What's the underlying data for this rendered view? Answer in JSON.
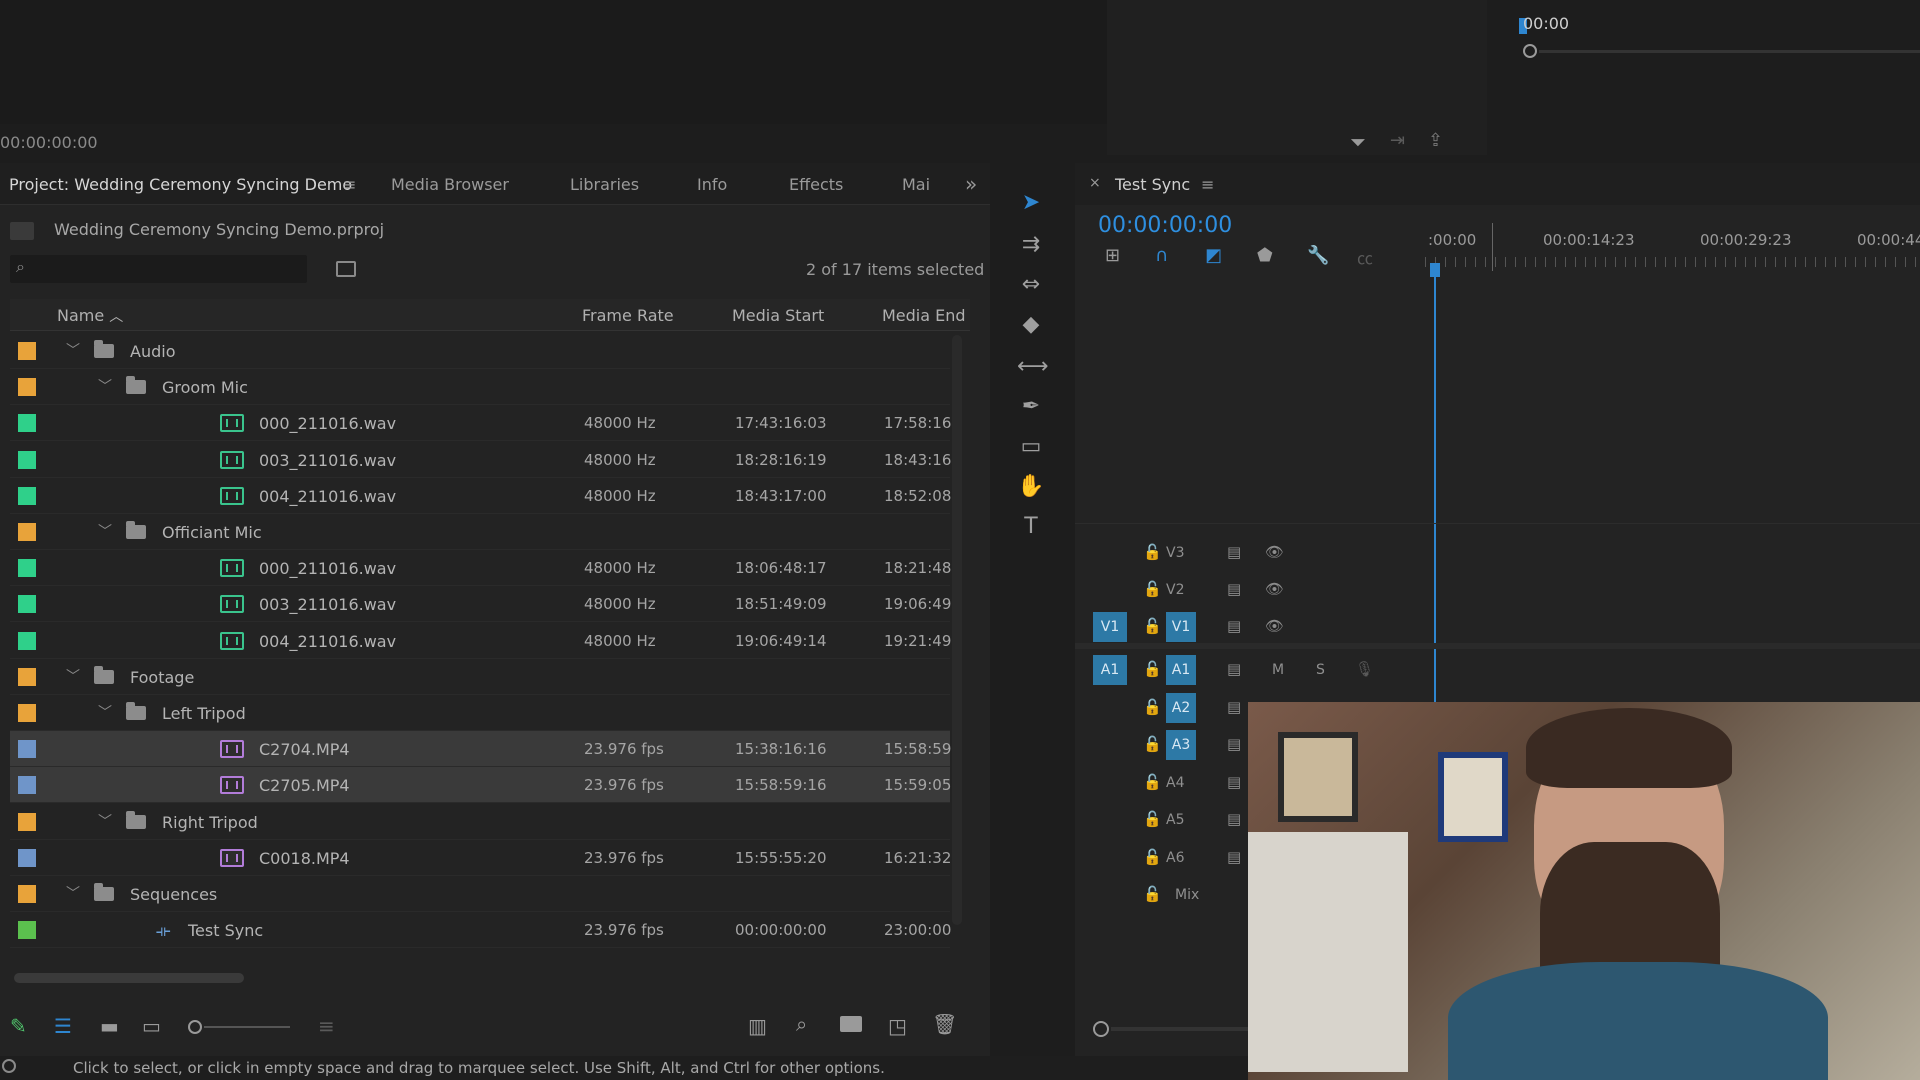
{
  "source_monitor": {
    "timecode": "00:00:00:00"
  },
  "program_monitor": {
    "timecode": "00:00"
  },
  "project_panel": {
    "tabs": [
      {
        "label": "Project: Wedding Ceremony Syncing Demo"
      },
      {
        "label": "Media Browser"
      },
      {
        "label": "Libraries"
      },
      {
        "label": "Info"
      },
      {
        "label": "Effects"
      },
      {
        "label": "Mai"
      }
    ],
    "project_file": "Wedding Ceremony Syncing Demo.prproj",
    "selection_count": "2 of 17 items selected",
    "columns": {
      "name": "Name",
      "frame_rate": "Frame Rate",
      "media_start": "Media Start",
      "media_end": "Media End"
    },
    "rows": [
      {
        "name": "Audio",
        "kind": "folder",
        "level": 0,
        "color": "#e8a33a",
        "fr": "",
        "start": "",
        "end": ""
      },
      {
        "name": "Groom Mic",
        "kind": "folder",
        "level": 1,
        "color": "#e8a33a",
        "fr": "",
        "start": "",
        "end": ""
      },
      {
        "name": "000_211016.wav",
        "kind": "audio",
        "level": 2,
        "color": "#2fd08a",
        "fr": "48000 Hz",
        "start": "17:43:16:03",
        "end": "17:58:16"
      },
      {
        "name": "003_211016.wav",
        "kind": "audio",
        "level": 2,
        "color": "#2fd08a",
        "fr": "48000 Hz",
        "start": "18:28:16:19",
        "end": "18:43:16"
      },
      {
        "name": "004_211016.wav",
        "kind": "audio",
        "level": 2,
        "color": "#2fd08a",
        "fr": "48000 Hz",
        "start": "18:43:17:00",
        "end": "18:52:08"
      },
      {
        "name": "Officiant Mic",
        "kind": "folder",
        "level": 1,
        "color": "#e8a33a",
        "fr": "",
        "start": "",
        "end": ""
      },
      {
        "name": "000_211016.wav",
        "kind": "audio",
        "level": 2,
        "color": "#2fd08a",
        "fr": "48000 Hz",
        "start": "18:06:48:17",
        "end": "18:21:48"
      },
      {
        "name": "003_211016.wav",
        "kind": "audio",
        "level": 2,
        "color": "#2fd08a",
        "fr": "48000 Hz",
        "start": "18:51:49:09",
        "end": "19:06:49"
      },
      {
        "name": "004_211016.wav",
        "kind": "audio",
        "level": 2,
        "color": "#2fd08a",
        "fr": "48000 Hz",
        "start": "19:06:49:14",
        "end": "19:21:49"
      },
      {
        "name": "Footage",
        "kind": "folder",
        "level": 0,
        "color": "#e8a33a",
        "fr": "",
        "start": "",
        "end": ""
      },
      {
        "name": "Left Tripod",
        "kind": "folder",
        "level": 1,
        "color": "#e8a33a",
        "fr": "",
        "start": "",
        "end": ""
      },
      {
        "name": "C2704.MP4",
        "kind": "video",
        "level": 2,
        "color": "#6f95c9",
        "fr": "23.976 fps",
        "start": "15:38:16:16",
        "end": "15:58:59",
        "selected": true
      },
      {
        "name": "C2705.MP4",
        "kind": "video",
        "level": 2,
        "color": "#6f95c9",
        "fr": "23.976 fps",
        "start": "15:58:59:16",
        "end": "15:59:05",
        "selected": true
      },
      {
        "name": "Right Tripod",
        "kind": "folder",
        "level": 1,
        "color": "#e8a33a",
        "fr": "",
        "start": "",
        "end": ""
      },
      {
        "name": "C0018.MP4",
        "kind": "video",
        "level": 2,
        "color": "#6f95c9",
        "fr": "23.976 fps",
        "start": "15:55:55:20",
        "end": "16:21:32"
      },
      {
        "name": "Sequences",
        "kind": "folder",
        "level": 0,
        "color": "#e8a33a",
        "fr": "",
        "start": "",
        "end": ""
      },
      {
        "name": "Test Sync",
        "kind": "sequence",
        "level": 1,
        "color": "#5bc04e",
        "fr": "23.976 fps",
        "start": "00:00:00:00",
        "end": "23:00:00"
      }
    ]
  },
  "timeline": {
    "sequence_name": "Test Sync",
    "timecode": "00:00:00:00",
    "ruler": [
      ":00:00",
      "00:00:14:23",
      "00:00:29:23",
      "00:00:44"
    ],
    "video_tracks": [
      "V3",
      "V2",
      "V1"
    ],
    "audio_tracks": [
      "A1",
      "A2",
      "A3",
      "A4",
      "A5",
      "A6"
    ],
    "v1_source": "V1",
    "a1_source": "A1",
    "mute": "M",
    "solo": "S",
    "mix": "Mix"
  },
  "status_bar": {
    "text": "Click to select, or click in empty space and drag to marquee select. Use Shift, Alt, and Ctrl for other options."
  }
}
